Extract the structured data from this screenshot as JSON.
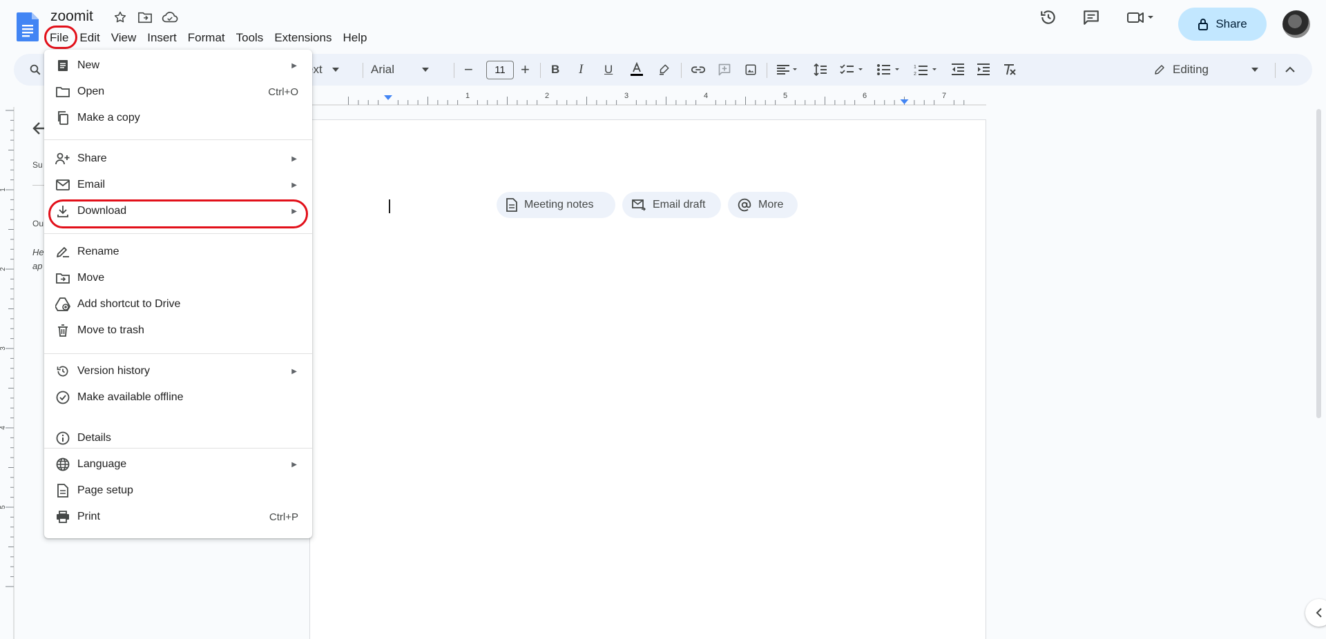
{
  "header": {
    "title": "zoomit",
    "menu": [
      "File",
      "Edit",
      "View",
      "Insert",
      "Format",
      "Tools",
      "Extensions",
      "Help"
    ],
    "share_label": "Share"
  },
  "toolbar": {
    "style_label": "ext",
    "font_family": "Arial",
    "font_size": "11",
    "mode_label": "Editing"
  },
  "ruler": {
    "labels": [
      "1",
      "2",
      "3",
      "4",
      "5",
      "6",
      "7"
    ]
  },
  "vruler": {
    "labels": [
      "1",
      "2",
      "3",
      "4",
      "5"
    ]
  },
  "left_panel": {
    "summary_label": "Su",
    "outline_label": "Ou",
    "hint_line1": "He",
    "hint_line2": "ap"
  },
  "chips": [
    {
      "label": "Meeting notes",
      "icon": "document-icon"
    },
    {
      "label": "Email draft",
      "icon": "email-draft-icon"
    },
    {
      "label": "More",
      "icon": "at-sign-icon"
    }
  ],
  "file_menu": {
    "items": [
      {
        "label": "New",
        "icon": "new-doc-icon",
        "submenu": true
      },
      {
        "label": "Open",
        "icon": "folder-open-icon",
        "shortcut": "Ctrl+O"
      },
      {
        "label": "Make a copy",
        "icon": "copy-icon"
      },
      {
        "label": "Share",
        "icon": "person-add-icon",
        "submenu": true
      },
      {
        "label": "Email",
        "icon": "email-icon",
        "submenu": true
      },
      {
        "label": "Download",
        "icon": "download-icon",
        "submenu": true
      },
      {
        "label": "Rename",
        "icon": "rename-icon"
      },
      {
        "label": "Move",
        "icon": "move-folder-icon"
      },
      {
        "label": "Add shortcut to Drive",
        "icon": "drive-shortcut-icon"
      },
      {
        "label": "Move to trash",
        "icon": "trash-icon"
      },
      {
        "label": "Version history",
        "icon": "history-icon",
        "submenu": true
      },
      {
        "label": "Make available offline",
        "icon": "offline-icon"
      },
      {
        "label": "Details",
        "icon": "info-icon"
      },
      {
        "label": "Language",
        "icon": "globe-icon",
        "submenu": true
      },
      {
        "label": "Page setup",
        "icon": "page-setup-icon"
      },
      {
        "label": "Print",
        "icon": "print-icon",
        "shortcut": "Ctrl+P"
      }
    ]
  },
  "colors": {
    "accent": "#0b57d0",
    "highlight_ring": "#e2101a",
    "share_bg": "#c2e7ff",
    "toolbar_bg": "#edf2fa"
  }
}
